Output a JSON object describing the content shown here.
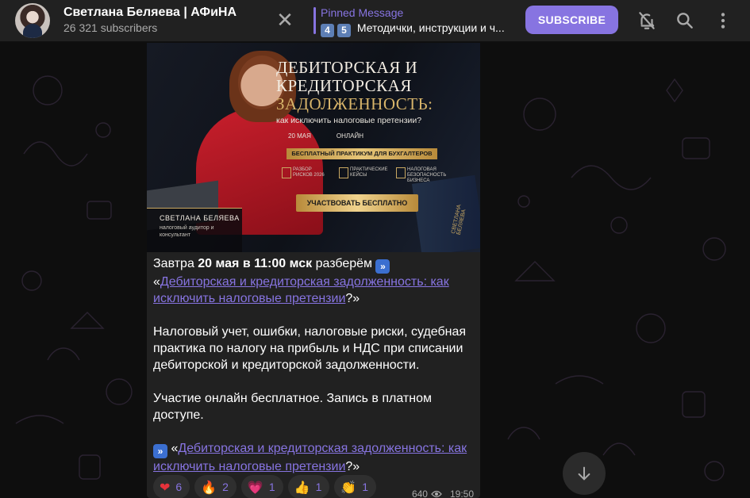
{
  "header": {
    "title": "Светлана Беляева | АФиНА",
    "subscribers": "26 321 subscribers",
    "pinned_label": "Pinned Message",
    "pinned_key1": "4",
    "pinned_key2": "5",
    "pinned_text": "Методички, инструкции и ч...",
    "subscribe_label": "SUBSCRIBE"
  },
  "banner": {
    "title_line1": "ДЕБИТОРСКАЯ И",
    "title_line2": "КРЕДИТОРСКАЯ",
    "title_line3": "ЗАДОЛЖЕННОСТЬ:",
    "subtitle": "как исключить налоговые претензии?",
    "date": "20 МАЯ",
    "format": "ОНЛАЙН",
    "strip": "БЕСПЛАТНЫЙ ПРАКТИКУМ ДЛЯ БУХГАЛТЕРОВ",
    "point1": "РАЗБОР РИСКОВ 2026",
    "point2": "ПРАКТИЧЕСКИЕ КЕЙСЫ",
    "point3": "НАЛОГОВАЯ БЕЗОПАСНОСТЬ БИЗНЕСА",
    "cta": "УЧАСТВОВАТЬ БЕСПЛАТНО",
    "name": "СВЕТЛАНА БЕЛЯЕВА",
    "role": "налоговый аудитор и консультант",
    "book_label": "СВЕТЛАНА БЕЛЯЕВА"
  },
  "message": {
    "intro_pre": "Завтра ",
    "intro_bold": "20 мая в 11:00 мск",
    "intro_post": " разберём ",
    "quote_open": "«",
    "link_text": "Дебиторская и кредиторская задолженность: как исключить налоговые претензии",
    "quote_close": "?»",
    "paragraph1": "Налоговый учет, ошибки, налоговые риски, судебная практика по налогу на прибыль и НДС при списании дебиторской и кредиторской задолженности.",
    "paragraph2": "Участие онлайн бесплатное. Запись в платном доступе.",
    "views": "640",
    "time": "19:50"
  },
  "reactions": [
    {
      "emoji": "❤",
      "count": "6"
    },
    {
      "emoji": "🔥",
      "count": "2"
    },
    {
      "emoji": "💗",
      "count": "1"
    },
    {
      "emoji": "👍",
      "count": "1"
    },
    {
      "emoji": "👏",
      "count": "1"
    }
  ],
  "colors": {
    "accent": "#8774e1",
    "header_bg": "#212121",
    "message_bg": "#212121"
  }
}
